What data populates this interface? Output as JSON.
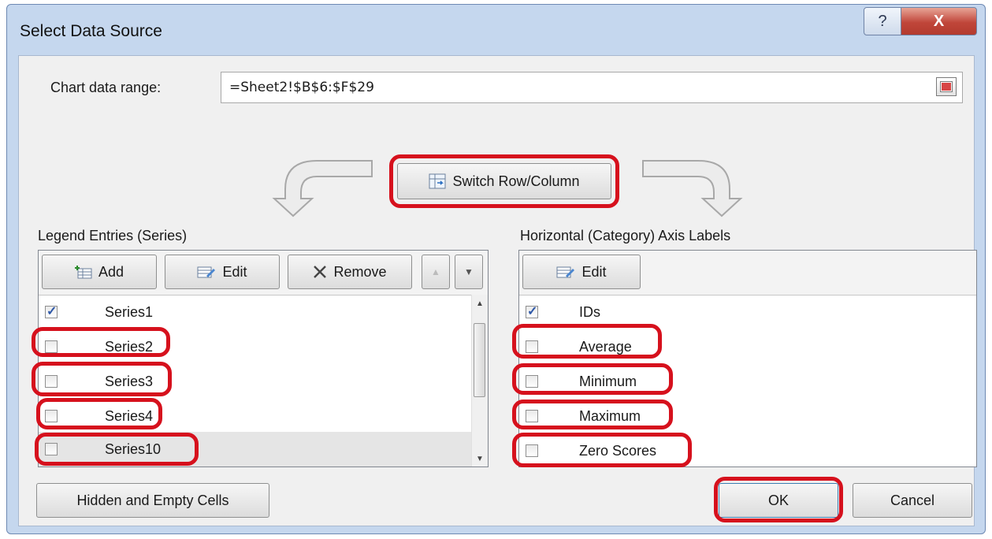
{
  "window": {
    "title": "Select Data Source",
    "help_glyph": "?",
    "close_glyph": "X"
  },
  "range": {
    "label": "Chart data range:",
    "value": "=Sheet2!$B$6:$F$29"
  },
  "switch_button": {
    "label": "Switch Row/Column"
  },
  "legend": {
    "heading": "Legend Entries (Series)",
    "add_label": "Add",
    "edit_label": "Edit",
    "remove_label": "Remove",
    "items": [
      {
        "label": "Series1",
        "checked": true
      },
      {
        "label": "Series2",
        "checked": false
      },
      {
        "label": "Series3",
        "checked": false
      },
      {
        "label": "Series4",
        "checked": false
      },
      {
        "label": "Series10",
        "checked": false,
        "selected": true
      }
    ]
  },
  "axis": {
    "heading": "Horizontal (Category) Axis Labels",
    "edit_label": "Edit",
    "items": [
      {
        "label": "IDs",
        "checked": true
      },
      {
        "label": "Average",
        "checked": false
      },
      {
        "label": "Minimum",
        "checked": false
      },
      {
        "label": "Maximum",
        "checked": false
      },
      {
        "label": "Zero Scores",
        "checked": false
      }
    ]
  },
  "footer": {
    "hidden_label": "Hidden and Empty Cells",
    "ok_label": "OK",
    "cancel_label": "Cancel"
  },
  "colors": {
    "highlight": "#d6111d",
    "frame": "#c5d7ee",
    "client": "#f0f0f0"
  }
}
